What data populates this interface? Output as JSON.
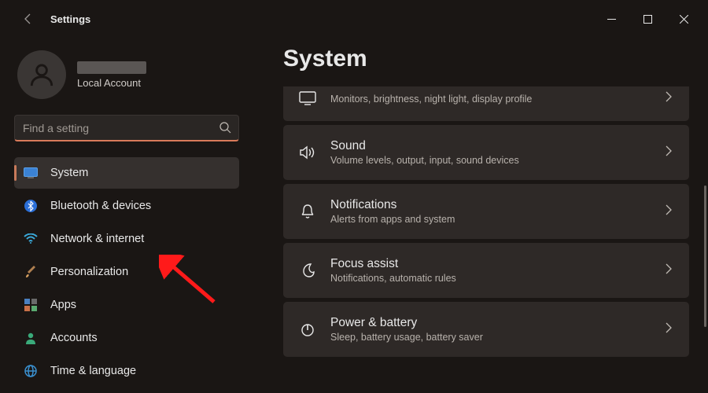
{
  "window": {
    "title": "Settings"
  },
  "user": {
    "account_type": "Local Account"
  },
  "search": {
    "placeholder": "Find a setting"
  },
  "sidebar": {
    "items": [
      {
        "label": "System",
        "active": true
      },
      {
        "label": "Bluetooth & devices"
      },
      {
        "label": "Network & internet"
      },
      {
        "label": "Personalization"
      },
      {
        "label": "Apps"
      },
      {
        "label": "Accounts"
      },
      {
        "label": "Time & language"
      }
    ]
  },
  "page": {
    "title": "System"
  },
  "cards": [
    {
      "title": "",
      "sub": "Monitors, brightness, night light, display profile"
    },
    {
      "title": "Sound",
      "sub": "Volume levels, output, input, sound devices"
    },
    {
      "title": "Notifications",
      "sub": "Alerts from apps and system"
    },
    {
      "title": "Focus assist",
      "sub": "Notifications, automatic rules"
    },
    {
      "title": "Power & battery",
      "sub": "Sleep, battery usage, battery saver"
    }
  ]
}
